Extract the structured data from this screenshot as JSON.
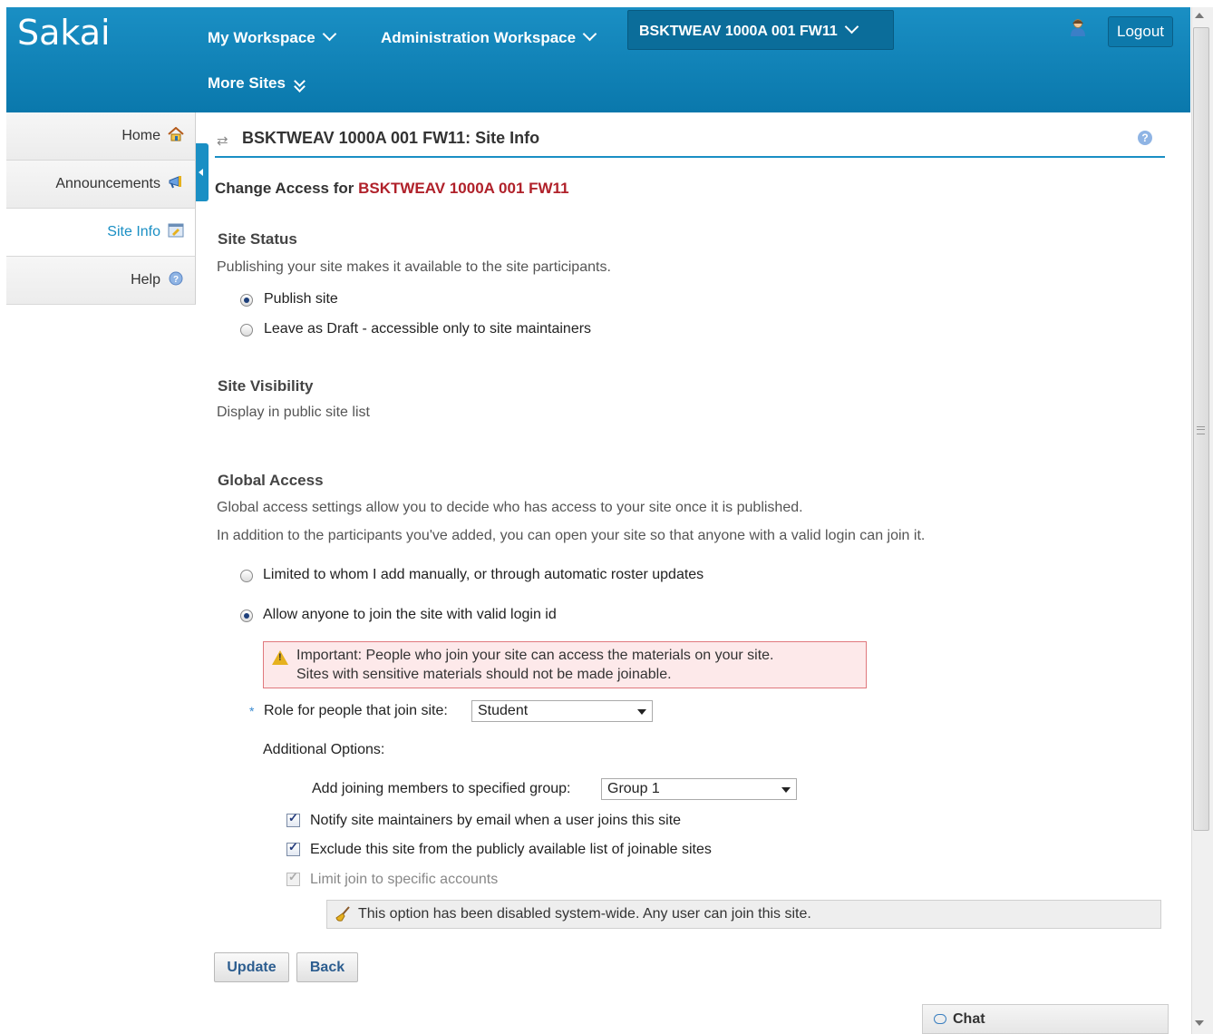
{
  "header": {
    "logo": "Sakai",
    "nav": {
      "my_workspace": "My Workspace",
      "admin_workspace": "Administration Workspace",
      "current_site": "BSKTWEAV 1000A 001 FW11",
      "more_sites": "More Sites"
    },
    "logout_label": "Logout"
  },
  "sidebar": {
    "items": [
      {
        "label": "Home",
        "icon": "home-icon"
      },
      {
        "label": "Announcements",
        "icon": "announcements-icon"
      },
      {
        "label": "Site Info",
        "icon": "site-info-icon",
        "active": true
      },
      {
        "label": "Help",
        "icon": "help-icon"
      }
    ]
  },
  "page": {
    "title": "BSKTWEAV 1000A 001 FW11: Site Info",
    "change_access_prefix": "Change Access for",
    "change_access_site": "BSKTWEAV 1000A 001 FW11",
    "site_status": {
      "heading": "Site Status",
      "description": "Publishing your site makes it available to the site participants.",
      "options": {
        "publish": "Publish site",
        "draft": "Leave as Draft - accessible only to site maintainers"
      },
      "selected": "publish"
    },
    "site_visibility": {
      "heading": "Site Visibility",
      "description": "Display in public site list"
    },
    "global_access": {
      "heading": "Global Access",
      "description1": "Global access settings allow you to decide who has access to your site once it is published.",
      "description2": "In addition to the participants you've added, you can open your site so that anyone with a valid login can join it.",
      "options": {
        "limited": "Limited to whom I add manually, or through automatic roster updates",
        "anyone": "Allow anyone to join the site with valid login id"
      },
      "selected": "anyone",
      "warning_line1": "Important: People who join your site can access the materials on your site.",
      "warning_line2": "Sites with sensitive materials should not be made joinable.",
      "required_marker": "*",
      "role_label": "Role for people that join site:",
      "role_value": "Student",
      "additional_options_label": "Additional Options:",
      "group_label": "Add joining members to specified group:",
      "group_value": "Group 1",
      "notify_label": "Notify site maintainers by email when a user joins this site",
      "exclude_label": "Exclude this site from the publicly available list of joinable sites",
      "limit_label": "Limit join to specific accounts",
      "info_message": "This option has been disabled system-wide. Any user can join this site."
    },
    "buttons": {
      "update": "Update",
      "back": "Back"
    }
  },
  "chat": {
    "label": "Chat"
  },
  "colors": {
    "header_blue": "#1a8fc4",
    "site_red": "#b0212a",
    "warning_bg": "#fde9ea"
  }
}
